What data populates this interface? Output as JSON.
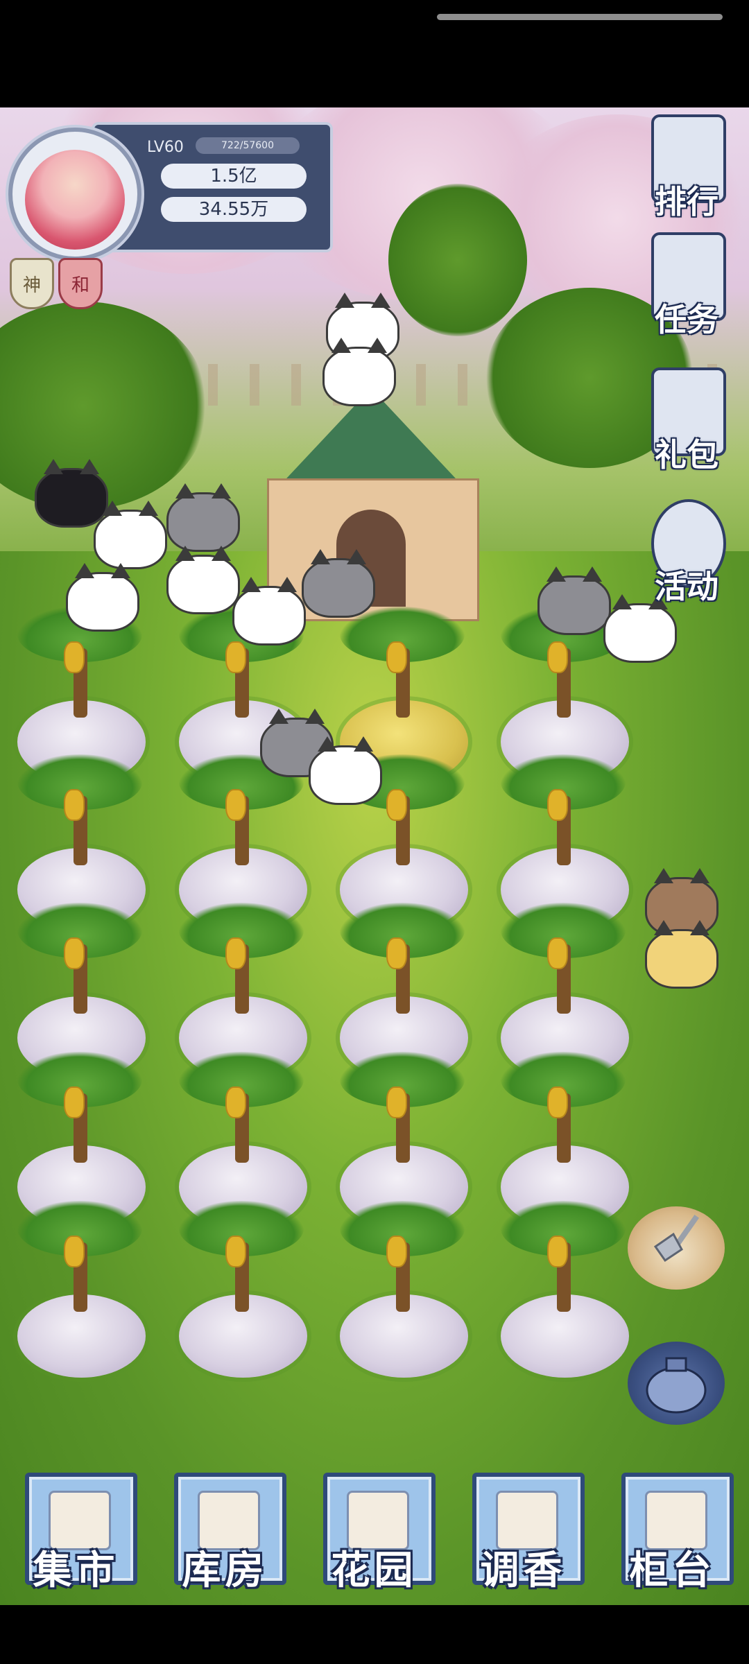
{
  "player": {
    "level": "LV60",
    "xp": "722/57600",
    "coins": "1.5亿",
    "hearts": "34.55万",
    "badges": [
      "神",
      "和"
    ]
  },
  "side_menu": [
    "排行",
    "任务",
    "礼包",
    "活动"
  ],
  "tools": [
    "shovel-icon",
    "bag-icon"
  ],
  "bottom_nav": [
    "集市",
    "库房",
    "花园",
    "调香",
    "柜台"
  ],
  "colors": {
    "nav_tile": "#9ec4ea",
    "nav_border": "#2f4a7a",
    "label_outline": "#1d2b52",
    "grass": "#5e9628",
    "blossom": "#e6c3d9"
  }
}
